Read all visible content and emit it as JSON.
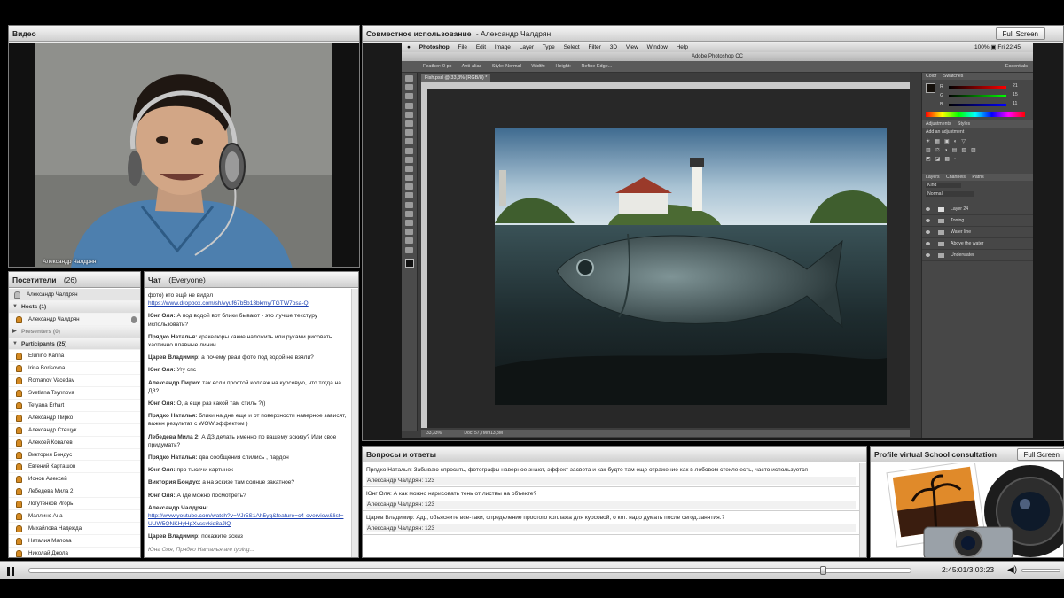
{
  "video": {
    "title": "Видео",
    "presenter": "Александр Чалдрян"
  },
  "attendees": {
    "title": "Посетители",
    "count": "(26)",
    "me": "Александр Чалдрян",
    "hosts_label": "Hosts (1)",
    "host": "Александр Чалдрян",
    "presenters_label": "Presenters (0)",
    "participants_label": "Participants (25)",
    "participants": [
      "Elunino Karina",
      "Irina Borisovna",
      "Romanov Vacedav",
      "Svetlana Tsynnova",
      "Tetyana Erhart",
      "Александр Пирко",
      "Александр Стещук",
      "Алексей Ковалев",
      "Виктория Бондус",
      "Евгений Карташов",
      "Ионов Алексей",
      "Лебедева Мила 2",
      "Логутенков Игорь",
      "Маллинс Ана",
      "Михайлова Надежда",
      "Наталия Малова",
      "Николай Джола"
    ]
  },
  "chat": {
    "title": "Чат",
    "audience": "(Everyone)",
    "intro_text": "фото) кто ещё не видел",
    "intro_link": "https://www.dropbox.com/sh/vyuf67b5b13bkmy/TGTW7osa-Q",
    "messages": [
      {
        "author": "Юнг Оля:",
        "text": "А под водой вот блики бывают - это лучше текстуру использовать?"
      },
      {
        "author": "Прядко Наталья:",
        "text": "кракелюры какие наложить или руками рисовать хаотично плавные линии"
      },
      {
        "author": "Царев Владимир:",
        "text": "а почему реал фото под водой не взяли?"
      },
      {
        "author": "Юнг Оля:",
        "text": "Угу спс"
      },
      {
        "author": "Александр Пирко:",
        "text": "так если простой коллаж на курсовую, что тогда на ДЗ?"
      },
      {
        "author": "Юнг Оля:",
        "text": "О, а еще раз какой там стиль ?))"
      },
      {
        "author": "Прядко Наталья:",
        "text": "блики на дне еще и от поверхности наверное зависят, важен результат с WOW эффектом )"
      },
      {
        "author": "Лебедева Мила 2:",
        "text": "А ДЗ делать именно по вашему эскизу? Или свое придумать?"
      },
      {
        "author": "Прядко Наталья:",
        "text": "два сообщения слились , пардон"
      },
      {
        "author": "Юнг Оля:",
        "text": "про тысячи картинок"
      },
      {
        "author": "Виктория Бондус:",
        "text": "а на эскизе там солнце закатное?"
      },
      {
        "author": "Юнг Оля:",
        "text": "А где можно посмотреть?"
      }
    ],
    "link_author": "Александр Чалдрян:",
    "link_url": "http://www.youtube.com/watch?v=VJr5S1Ah5yg&feature=c4-overview&list=UUW5QNKHyHpXvssvkid8aJlQ",
    "last_author": "Царев Владимир:",
    "last_text": "покажите эскиз",
    "typing": "Юнг Оля, Прядко Наталья are typing..."
  },
  "share": {
    "title": "Совместное использование",
    "presenter": "- Александр Чалдрян",
    "fullscreen": "Full Screen",
    "mac_menu": [
      "Photoshop",
      "File",
      "Edit",
      "Image",
      "Layer",
      "Type",
      "Select",
      "Filter",
      "3D",
      "View",
      "Window",
      "Help"
    ],
    "mac_right": "100% ▣  Fri 22:45",
    "app_title": "Adobe Photoshop CC",
    "options": [
      "Feather: 0 px",
      "Anti-alias",
      "Style: Normal",
      "Width:",
      "Height:",
      "Refine Edge..."
    ],
    "workspace": "Essentials",
    "doc_tab": "Fish.psd @ 33,3% (RGB/8) *",
    "status_zoom": "33,33%",
    "status_doc": "Doc: 57,7M/913,8M",
    "panels": {
      "color_tabs": [
        "Color",
        "Swatches"
      ],
      "rgb": [
        {
          "label": "R",
          "value": "21"
        },
        {
          "label": "G",
          "value": "15"
        },
        {
          "label": "B",
          "value": "11"
        }
      ],
      "adj_tabs": [
        "Adjustments",
        "Styles"
      ],
      "adj_label": "Add an adjustment",
      "layer_tabs": [
        "Layers",
        "Channels",
        "Paths"
      ],
      "layer_kind": "Kind",
      "layer_mode": "Normal",
      "layers": [
        "Layer 24",
        "Toning",
        "Water line",
        "Above the water",
        "Underwater"
      ]
    }
  },
  "qa": {
    "title": "Вопросы и ответы",
    "items": [
      {
        "q": "Прядко Наталья: Забываю спросить, фотографы наверное знают, эффект засвета и как-будто там еще отражение как в лобовом стекле есть, часто используется",
        "a": "Александр Чалдрян: 123"
      },
      {
        "q": "Юнг Оля: А как можно нарисовать тень от листвы на объекте?",
        "a": "Александр Чалдрян: 123"
      },
      {
        "q": "Царев Владимир: Адр, объясните все-таки, определение простого коллажа для курсовой, о кот. надо думать после сегод.занятия.?",
        "a": "Александр Чалдрян: 123"
      }
    ]
  },
  "profile": {
    "title": "Profile virtual School consultation",
    "fullscreen": "Full Screen"
  },
  "player": {
    "time": "2:45:01/3:03:23",
    "progress": 0.904
  },
  "colors": {
    "accent": "#1b3fb0",
    "pod_bg": "#ececec",
    "ps_bg": "#3d3d3d"
  }
}
